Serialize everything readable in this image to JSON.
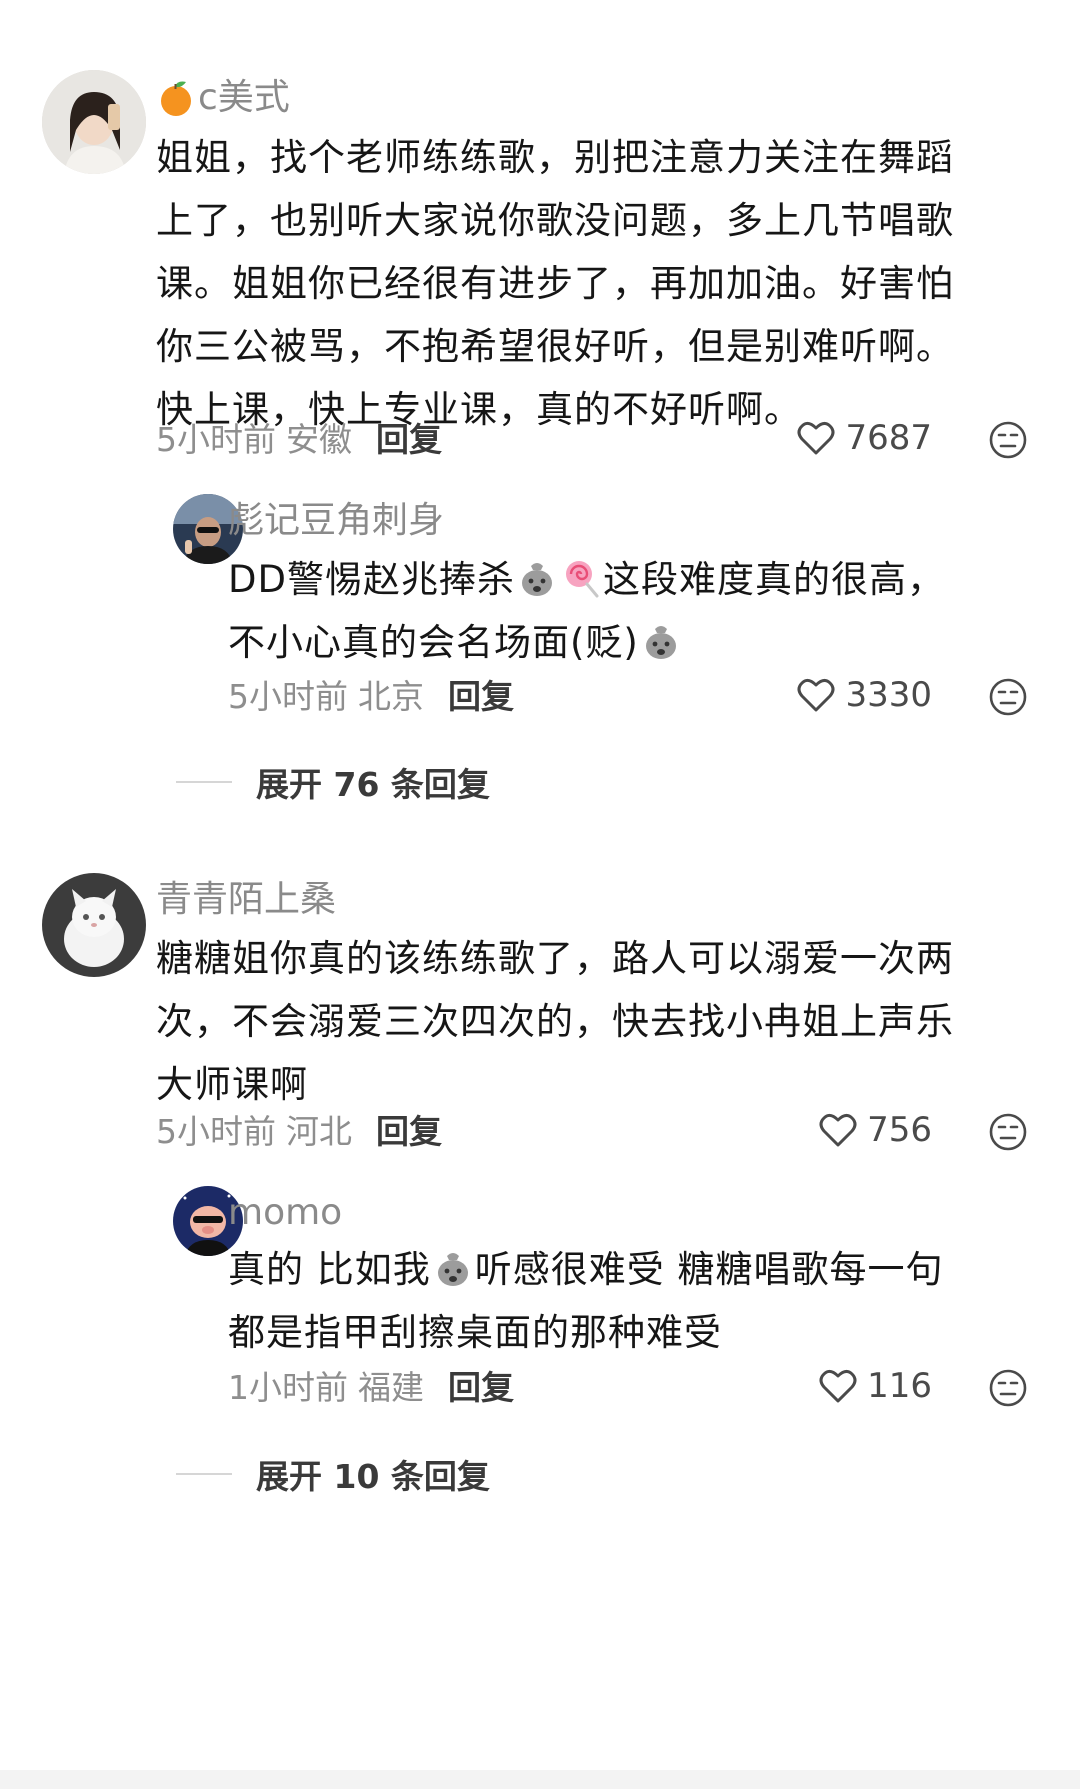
{
  "comments": [
    {
      "username": "c美式",
      "text_lines": [
        "姐姐，找个老师练练歌，别把注意力关注在舞蹈",
        "上了，也别听大家说你歌没问题，多上几节唱歌",
        "课。姐姐你已经很有进步了，再加加油。好害怕",
        "你三公被骂，不抱希望很好听，但是别难听啊。",
        "快上课，快上专业课，真的不好听啊。"
      ],
      "time": "5小时前",
      "location": "安徽",
      "reply_label": "回复",
      "likes": "7687",
      "replies": [
        {
          "username": "彪记豆角刺身",
          "text_line1_a": "DD警惕赵兆捧杀",
          "text_line1_b": "这段难度真的很高，",
          "text_line2_a": "不小心真的会名场面(贬)",
          "time": "5小时前",
          "location": "北京",
          "reply_label": "回复",
          "likes": "3330"
        }
      ],
      "expand_label": "展开 76 条回复"
    },
    {
      "username": "青青陌上桑",
      "text_lines": [
        "糖糖姐你真的该练练歌了，路人可以溺爱一次两",
        "次，不会溺爱三次四次的，快去找小冉姐上声乐",
        "大师课啊"
      ],
      "time": "5小时前",
      "location": "河北",
      "reply_label": "回复",
      "likes": "756",
      "replies": [
        {
          "username": "momo",
          "text_line1_a": "真的 比如我",
          "text_line1_b": "听感很难受 糖糖唱歌每一句",
          "text_line2_a": "都是指甲刮擦桌面的那种难受",
          "time": "1小时前",
          "location": "福建",
          "reply_label": "回复",
          "likes": "116"
        }
      ],
      "expand_label": "展开 10 条回复"
    }
  ],
  "colors": {
    "text": "#161616",
    "muted": "#8e8e8e",
    "username": "#8a8a8a",
    "reply": "#3a3a3a",
    "background": "#ffffff"
  },
  "icons": {
    "username_badge": "orange-icon",
    "like": "heart-outline-icon",
    "dislike": "meh-face-icon",
    "emoji_bag": "moneybag-face-emoji",
    "emoji_lollipop": "lollipop-emoji"
  }
}
